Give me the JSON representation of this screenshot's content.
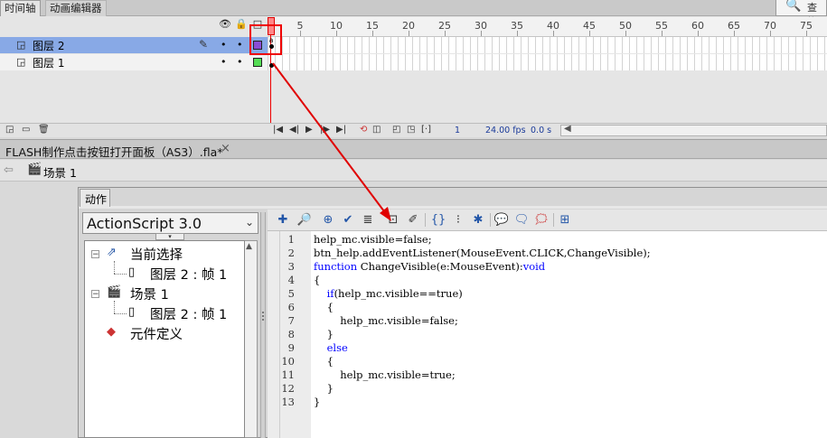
{
  "timeline": {
    "tabs": [
      "时间轴",
      "动画编辑器"
    ],
    "search_label": "查找",
    "ruler_labels": [
      "5",
      "10",
      "15",
      "20",
      "25",
      "30",
      "35",
      "40",
      "45",
      "50",
      "55",
      "60",
      "65",
      "70",
      "75"
    ],
    "playhead_label": "1",
    "layers": [
      {
        "name": "图层 2",
        "selected": true,
        "color": "#8a4dd6"
      },
      {
        "name": "图层 1",
        "selected": false,
        "color": "#55dd55"
      }
    ],
    "current_frame": "1",
    "fps": "24.00 fps",
    "time": "0.0 s"
  },
  "document": {
    "tab_title": "FLASH制作点击按钮打开面板（AS3）.fla*",
    "scene_label": "场景 1"
  },
  "actions": {
    "tab_label": "动作",
    "language": "ActionScript 3.0",
    "tree": [
      {
        "label": "当前选择",
        "level": 0,
        "expander": "−",
        "icon": "current-selection-icon"
      },
      {
        "label": "图层 2 : 帧 1",
        "level": 1,
        "icon": "frame-icon"
      },
      {
        "label": "场景 1",
        "level": 0,
        "expander": "−",
        "icon": "scene-icon"
      },
      {
        "label": "图层 2 : 帧 1",
        "level": 1,
        "icon": "frame-icon"
      },
      {
        "label": "元件定义",
        "level": 0,
        "icon": "symbol-definitions-icon"
      }
    ],
    "code_lines": [
      {
        "n": "1",
        "text": "help_mc.visible=false;"
      },
      {
        "n": "2",
        "text": "btn_help.addEventListener(MouseEvent.CLICK,ChangeVisible);"
      },
      {
        "n": "3",
        "text": "function ChangeVisible(e:MouseEvent):void"
      },
      {
        "n": "4",
        "text": "{"
      },
      {
        "n": "5",
        "text": "    if(help_mc.visible==true)"
      },
      {
        "n": "6",
        "text": "    {"
      },
      {
        "n": "7",
        "text": "        help_mc.visible=false;"
      },
      {
        "n": "8",
        "text": "    }"
      },
      {
        "n": "9",
        "text": "    else"
      },
      {
        "n": "10",
        "text": "    {"
      },
      {
        "n": "11",
        "text": "        help_mc.visible=true;"
      },
      {
        "n": "12",
        "text": "    }"
      },
      {
        "n": "13",
        "text": "}"
      }
    ]
  },
  "annotation": {
    "color": "#e00000"
  }
}
